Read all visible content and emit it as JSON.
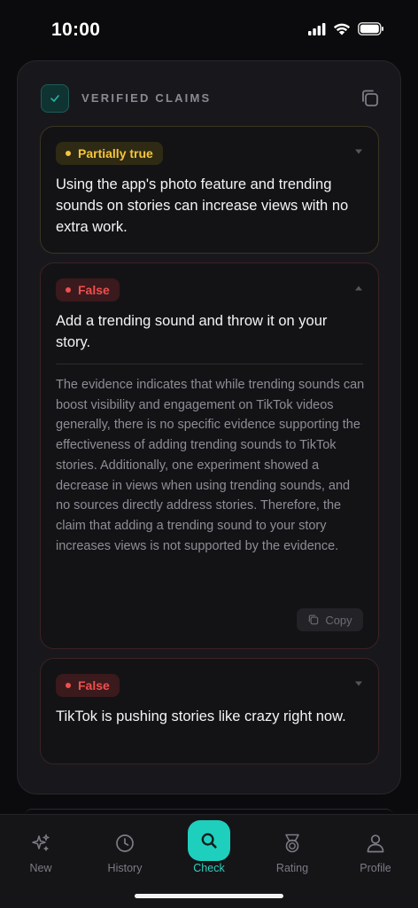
{
  "status_bar": {
    "time": "10:00"
  },
  "header": {
    "title": "VERIFIED CLAIMS"
  },
  "claims": [
    {
      "verdict": "Partially true",
      "text": "Using the app's photo feature and trending sounds on stories can increase views with no extra work.",
      "expanded": false
    },
    {
      "verdict": "False",
      "text": "Add a trending sound and throw it on your story.",
      "expanded": true,
      "explanation": "The evidence indicates that while trending sounds can boost visibility and engagement on TikTok videos generally, there is no specific evidence supporting the effectiveness of adding trending sounds to TikTok stories. Additionally, one experiment showed a decrease in views when using trending sounds, and no sources directly address stories. Therefore, the claim that adding a trending sound to your story increases views is not supported by the evidence.",
      "copy_label": "Copy"
    },
    {
      "verdict": "False",
      "text": "TikTok is pushing stories like crazy right now.",
      "expanded": false
    }
  ],
  "tabs": [
    {
      "label": "New",
      "icon": "sparkles-icon"
    },
    {
      "label": "History",
      "icon": "clock-icon"
    },
    {
      "label": "Check",
      "icon": "search-icon",
      "active": true
    },
    {
      "label": "Rating",
      "icon": "medal-icon"
    },
    {
      "label": "Profile",
      "icon": "person-icon"
    }
  ],
  "colors": {
    "accent": "#1fcfbe",
    "partial": "#f5c53c",
    "false": "#ef4f4f",
    "background": "#0b0b0d",
    "card": "#18181c"
  }
}
